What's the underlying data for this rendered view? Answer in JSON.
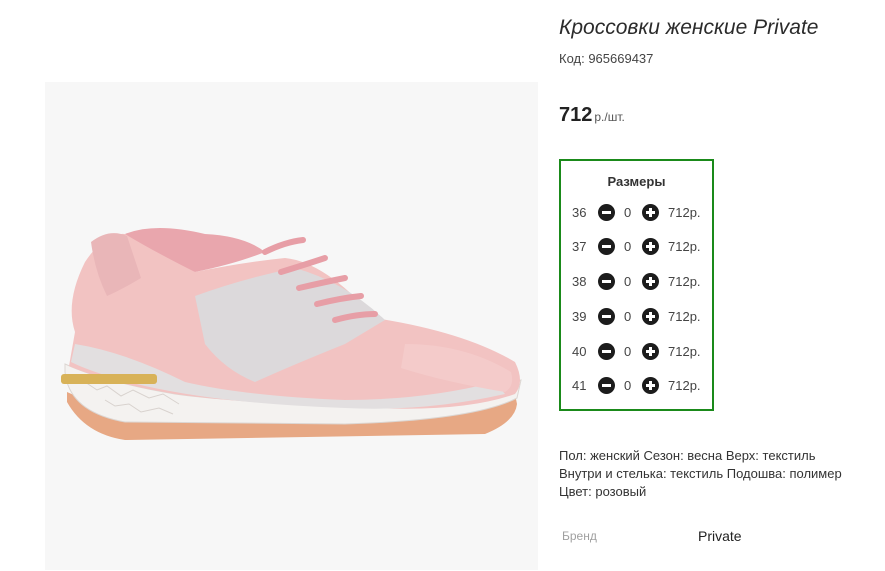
{
  "product": {
    "title": "Кроссовки женские Private",
    "code": "Код: 965669437",
    "price": "712",
    "price_unit": "р./шт.",
    "image_alt": "product-photo"
  },
  "sizes": {
    "title": "Размеры",
    "rows": [
      {
        "size": "36",
        "qty": "0",
        "price": "712р."
      },
      {
        "size": "37",
        "qty": "0",
        "price": "712р."
      },
      {
        "size": "38",
        "qty": "0",
        "price": "712р."
      },
      {
        "size": "39",
        "qty": "0",
        "price": "712р."
      },
      {
        "size": "40",
        "qty": "0",
        "price": "712р."
      },
      {
        "size": "41",
        "qty": "0",
        "price": "712р."
      }
    ]
  },
  "description": {
    "line1": "Пол: женский Сезон: весна Верх: текстиль",
    "line2": "Внутри и стелька: текстиль Подошва: полимер",
    "line3": "Цвет: розовый"
  },
  "brand": {
    "label": "Бренд",
    "value": "Private"
  },
  "colors": {
    "frame": "#1a8a1a",
    "button": "#1c1c1c"
  },
  "icons": {
    "minus": "minus-circle-icon",
    "plus": "plus-circle-icon"
  }
}
